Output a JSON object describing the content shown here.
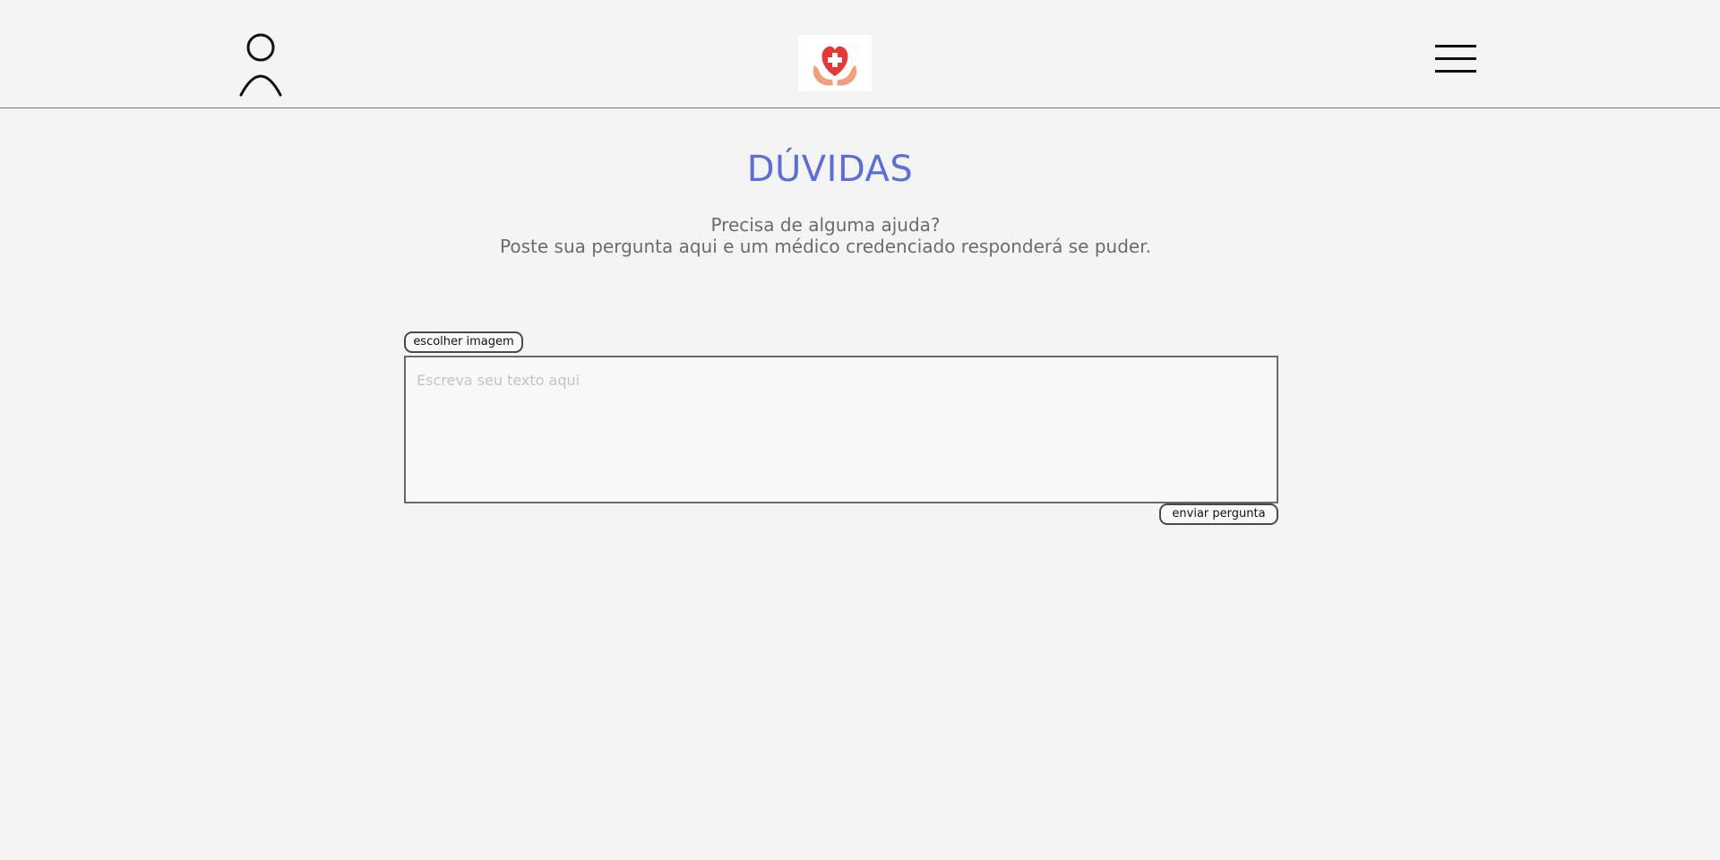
{
  "header": {
    "user_icon": "user-profile-icon",
    "logo_icon": "heart-medical-cross-hands-logo",
    "menu_icon": "hamburger-menu-icon"
  },
  "main": {
    "title": "DÚVIDAS",
    "subtitle_line1": "Precisa de alguma ajuda?",
    "subtitle_line2": "Poste sua pergunta aqui e um médico credenciado responderá se puder."
  },
  "form": {
    "choose_image_label": "escolher imagem",
    "text_placeholder": "Escreva seu texto aqui",
    "text_value": "",
    "submit_label": "enviar pergunta"
  },
  "colors": {
    "background": "#f4f4f4",
    "title": "#5b6fd4",
    "subtitle": "#6b6b6b",
    "header_border": "#8a7272",
    "logo_heart": "#e53935",
    "logo_hands": "#f0a07a"
  }
}
